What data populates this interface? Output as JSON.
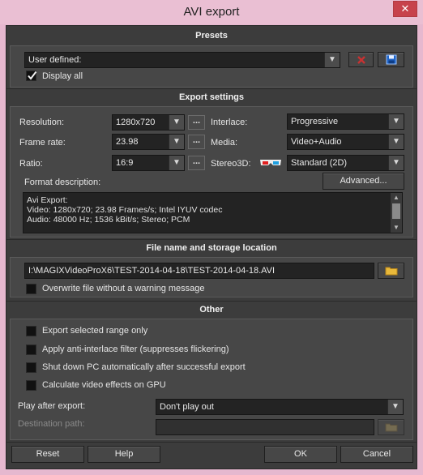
{
  "window": {
    "title": "AVI export",
    "close_glyph": "✕"
  },
  "presets": {
    "heading": "Presets",
    "preset_value": "User defined:",
    "display_all_label": "Display all",
    "display_all_checked": true
  },
  "export_settings": {
    "heading": "Export settings",
    "resolution_label": "Resolution:",
    "resolution_value": "1280x720",
    "frame_rate_label": "Frame rate:",
    "frame_rate_value": "23.98",
    "ratio_label": "Ratio:",
    "ratio_value": "16:9",
    "more_glyph": "...",
    "interlace_label": "Interlace:",
    "interlace_value": "Progressive",
    "media_label": "Media:",
    "media_value": "Video+Audio",
    "stereo3d_label": "Stereo3D:",
    "stereo3d_value": "Standard (2D)",
    "format_description_label": "Format description:",
    "advanced_label": "Advanced...",
    "format_description_lines": [
      "Avi Export:",
      "Video: 1280x720; 23.98 Frames/s; Intel IYUV codec",
      "Audio: 48000 Hz; 1536 kBit/s; Stereo; PCM"
    ]
  },
  "file": {
    "heading": "File name and storage location",
    "path_value": "I:\\MAGIXVideoProX6\\TEST-2014-04-18\\TEST-2014-04-18.AVI",
    "overwrite_label": "Overwrite file without a warning message",
    "overwrite_checked": false
  },
  "other": {
    "heading": "Other",
    "options": [
      "Export selected range only",
      "Apply anti-interlace filter (suppresses flickering)",
      "Shut down PC automatically after successful export",
      "Calculate video effects on GPU"
    ],
    "play_after_label": "Play after export:",
    "play_after_value": "Don't play out",
    "destination_label": "Destination path:",
    "destination_value": ""
  },
  "footer": {
    "reset": "Reset",
    "help": "Help",
    "ok": "OK",
    "cancel": "Cancel"
  },
  "colors": {
    "background": "#3c3c3c",
    "field": "#232323",
    "title_bar": "#eabfd3",
    "close": "#c7424c",
    "delete_icon": "#c83232",
    "save_icon": "#1e64c8"
  },
  "icons": {
    "dropdown": "chevron-down-icon",
    "delete": "delete-icon",
    "save": "save-icon",
    "folder": "folder-icon",
    "glasses": "3d-glasses-icon",
    "check": "checkmark-icon"
  }
}
